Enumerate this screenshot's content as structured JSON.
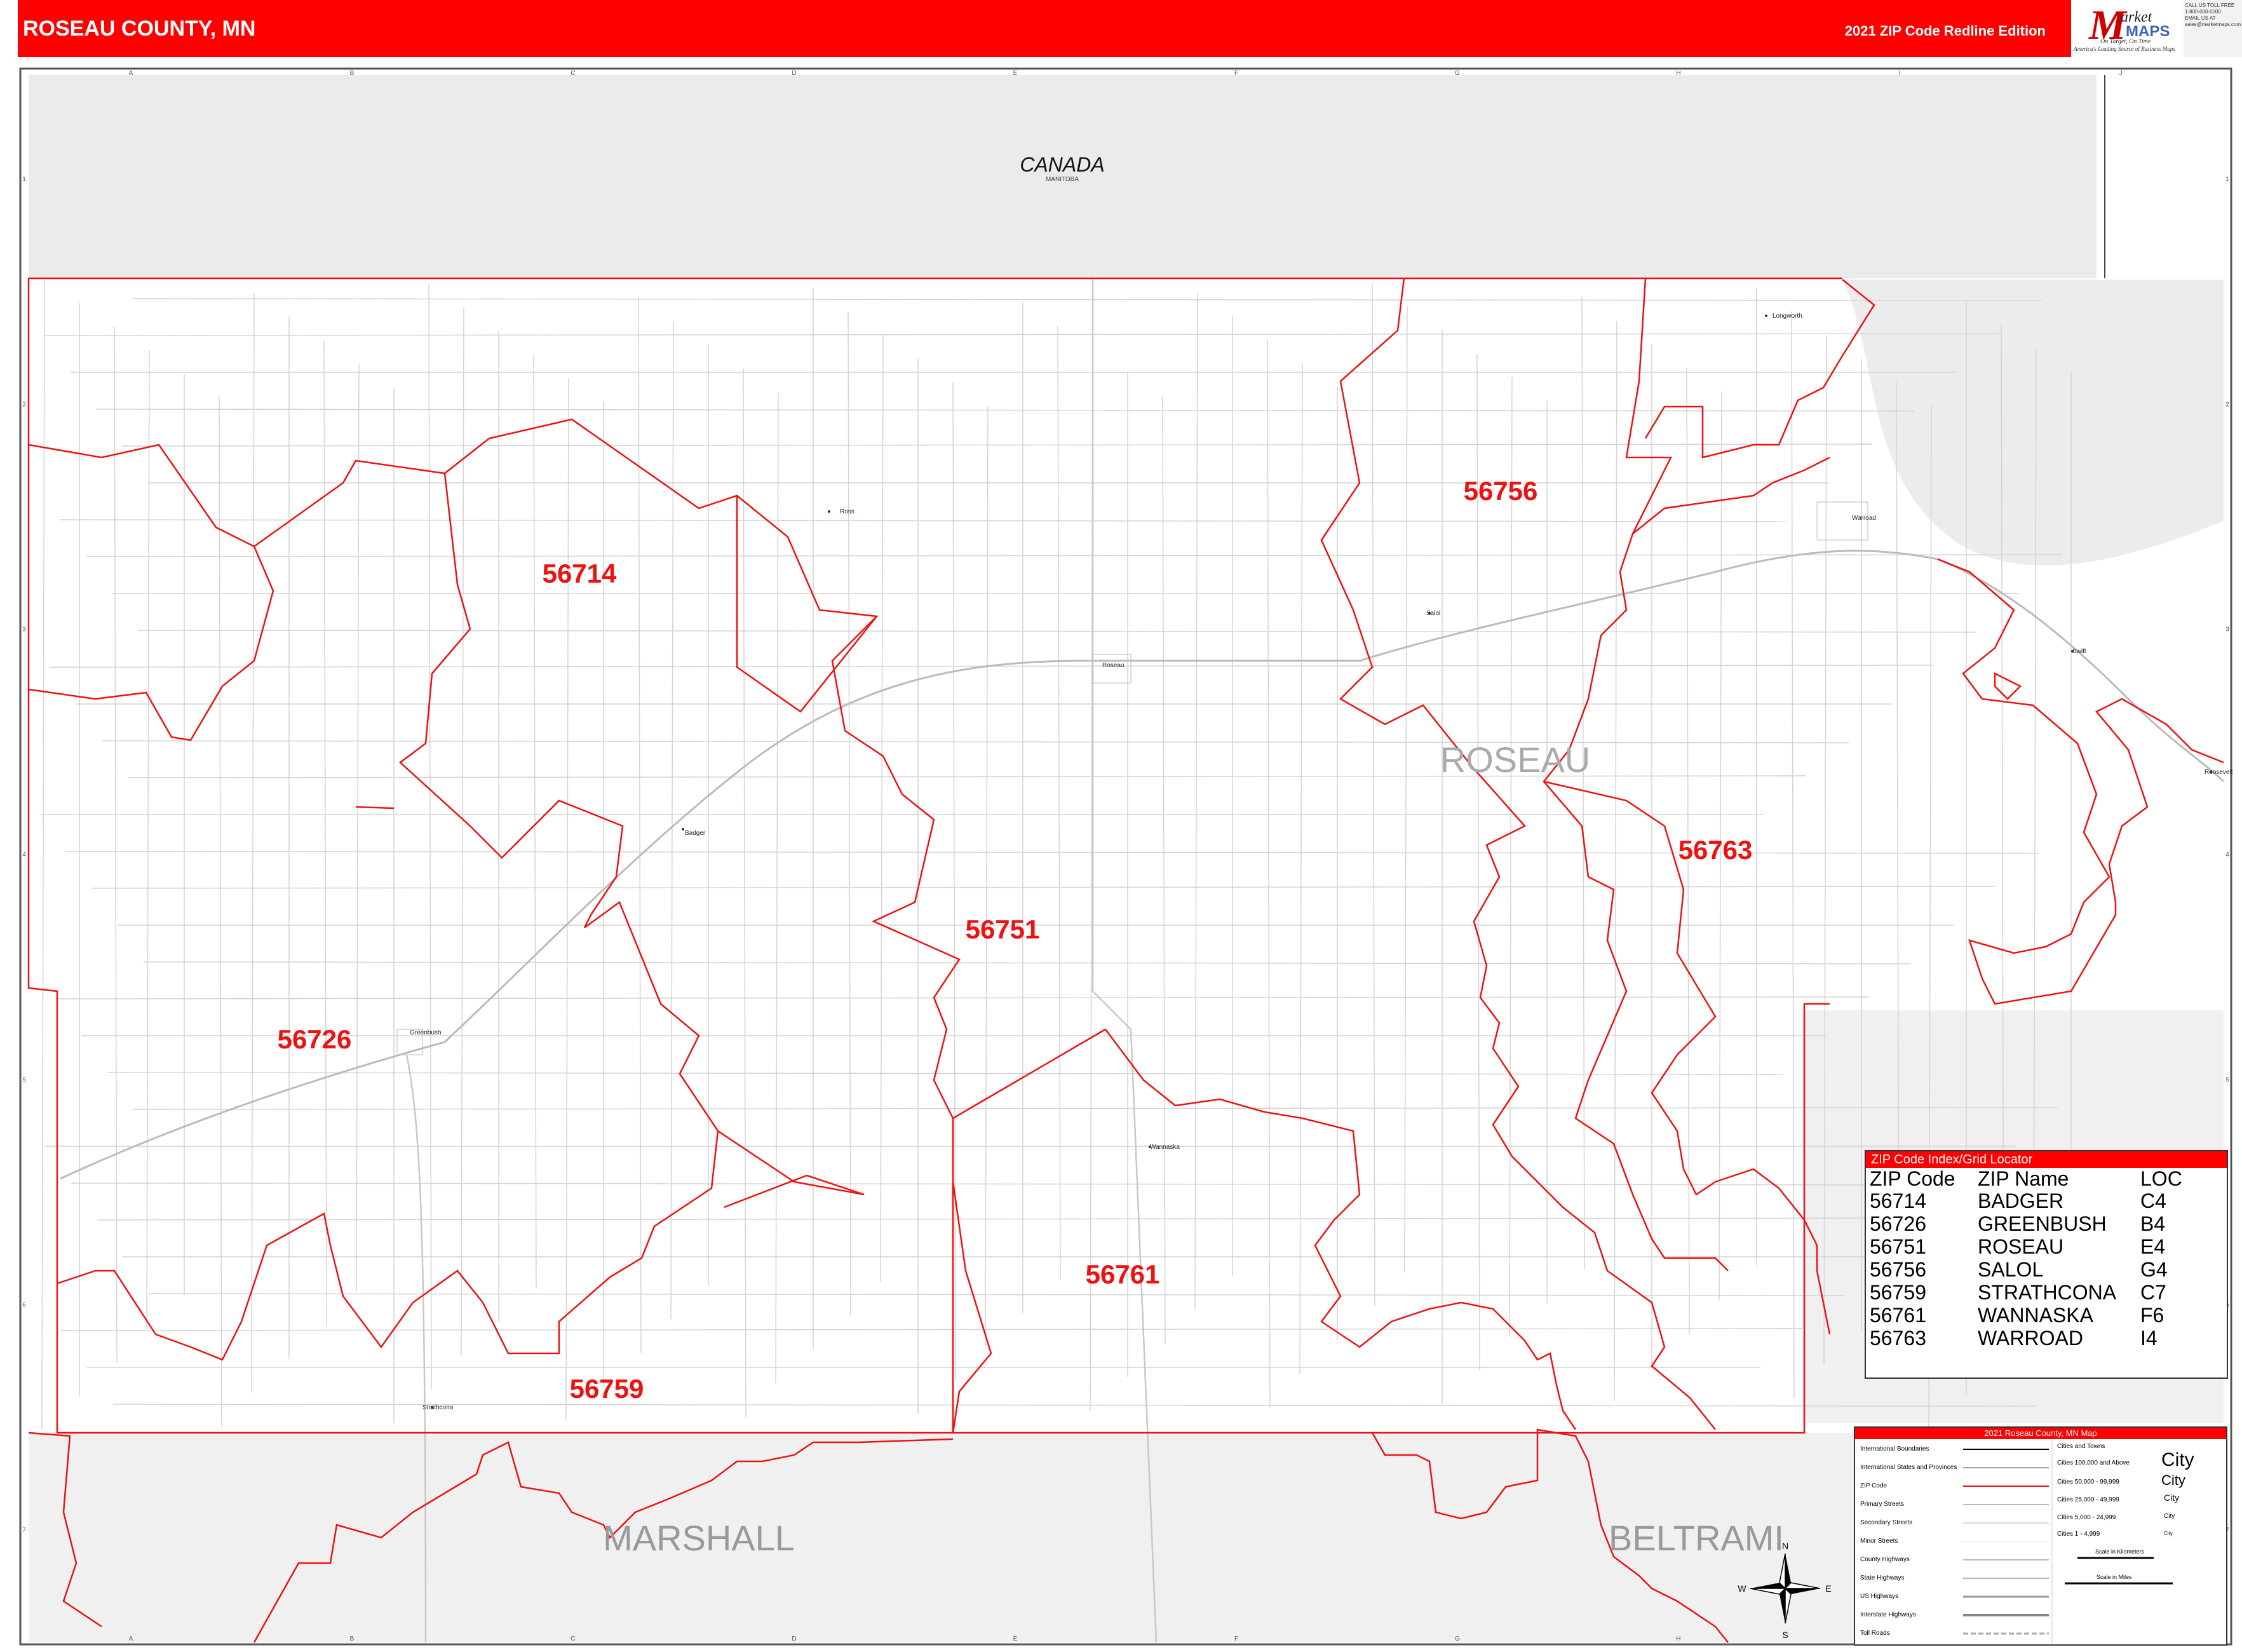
{
  "header": {
    "title": "ROSEAU COUNTY, MN",
    "edition": "2021 ZIP Code Redline Edition"
  },
  "logo": {
    "letter": "M",
    "arket": "arket",
    "maps": "MAPS",
    "tagline": "On Target, On Time",
    "subtagline": "America's Leading Source of Business Maps"
  },
  "contact": [
    "CALL US TOLL FREE",
    "1-800-000-0000",
    "EMAIL US AT",
    "sales@marketmaps.com"
  ],
  "grid": {
    "columns": [
      "A",
      "B",
      "C",
      "D",
      "E",
      "F",
      "G",
      "H",
      "I",
      "J"
    ],
    "rows": [
      "1",
      "2",
      "3",
      "4",
      "5",
      "6",
      "7"
    ]
  },
  "regions": {
    "canada": "CANADA",
    "manitoba": "MANITOBA",
    "county": "ROSEAU",
    "marshall": "MARSHALL",
    "beltrami": "BELTRAMI"
  },
  "zip_labels": [
    "56714",
    "56726",
    "56751",
    "56756",
    "56759",
    "56761",
    "56763"
  ],
  "towns": [
    "Ross",
    "Roseau",
    "Badger",
    "Greenbush",
    "Salol",
    "Warroad",
    "Longworth",
    "Wannaska",
    "Strathcona",
    "Swift",
    "Roosevelt"
  ],
  "zip_index": {
    "title": "ZIP Code Index/Grid Locator",
    "headers": [
      "ZIP Code",
      "ZIP Name",
      "LOC"
    ],
    "rows": [
      [
        "56714",
        "BADGER",
        "C4"
      ],
      [
        "56726",
        "GREENBUSH",
        "B4"
      ],
      [
        "56751",
        "ROSEAU",
        "E4"
      ],
      [
        "56756",
        "SALOL",
        "G4"
      ],
      [
        "56759",
        "STRATHCONA",
        "C7"
      ],
      [
        "56761",
        "WANNASKA",
        "F6"
      ],
      [
        "56763",
        "WARROAD",
        "I4"
      ]
    ]
  },
  "legend": {
    "title": "2021 Roseau County, MN Map",
    "items": [
      "International Boundaries",
      "International States and Provinces",
      "ZIP Code",
      "Primary Streets",
      "Secondary Streets",
      "Minor Streets",
      "County Highways",
      "State Highways",
      "US Highways",
      "Interstate Highways",
      "Toll Roads"
    ],
    "cities_heading": "Cities and Towns",
    "cities": [
      {
        "range": "Cities 100,000 and Above",
        "sample": "City"
      },
      {
        "range": "Cities 50,000 - 99,999",
        "sample": "City"
      },
      {
        "range": "Cities 25,000 - 49,999",
        "sample": "City"
      },
      {
        "range": "Cities 5,000 - 24,999",
        "sample": "City"
      },
      {
        "range": "Cities 1 - 4,999",
        "sample": "City"
      }
    ],
    "scale_km": "Scale in Kilometers",
    "scale_mi": "Scale in Miles"
  },
  "compass": {
    "n": "N",
    "s": "S",
    "e": "E",
    "w": "W"
  },
  "colors": {
    "zip_red": "#ee1111",
    "header_red": "#ff0000",
    "outside_gray": "#ebebeb",
    "region_gray": "#999999"
  }
}
